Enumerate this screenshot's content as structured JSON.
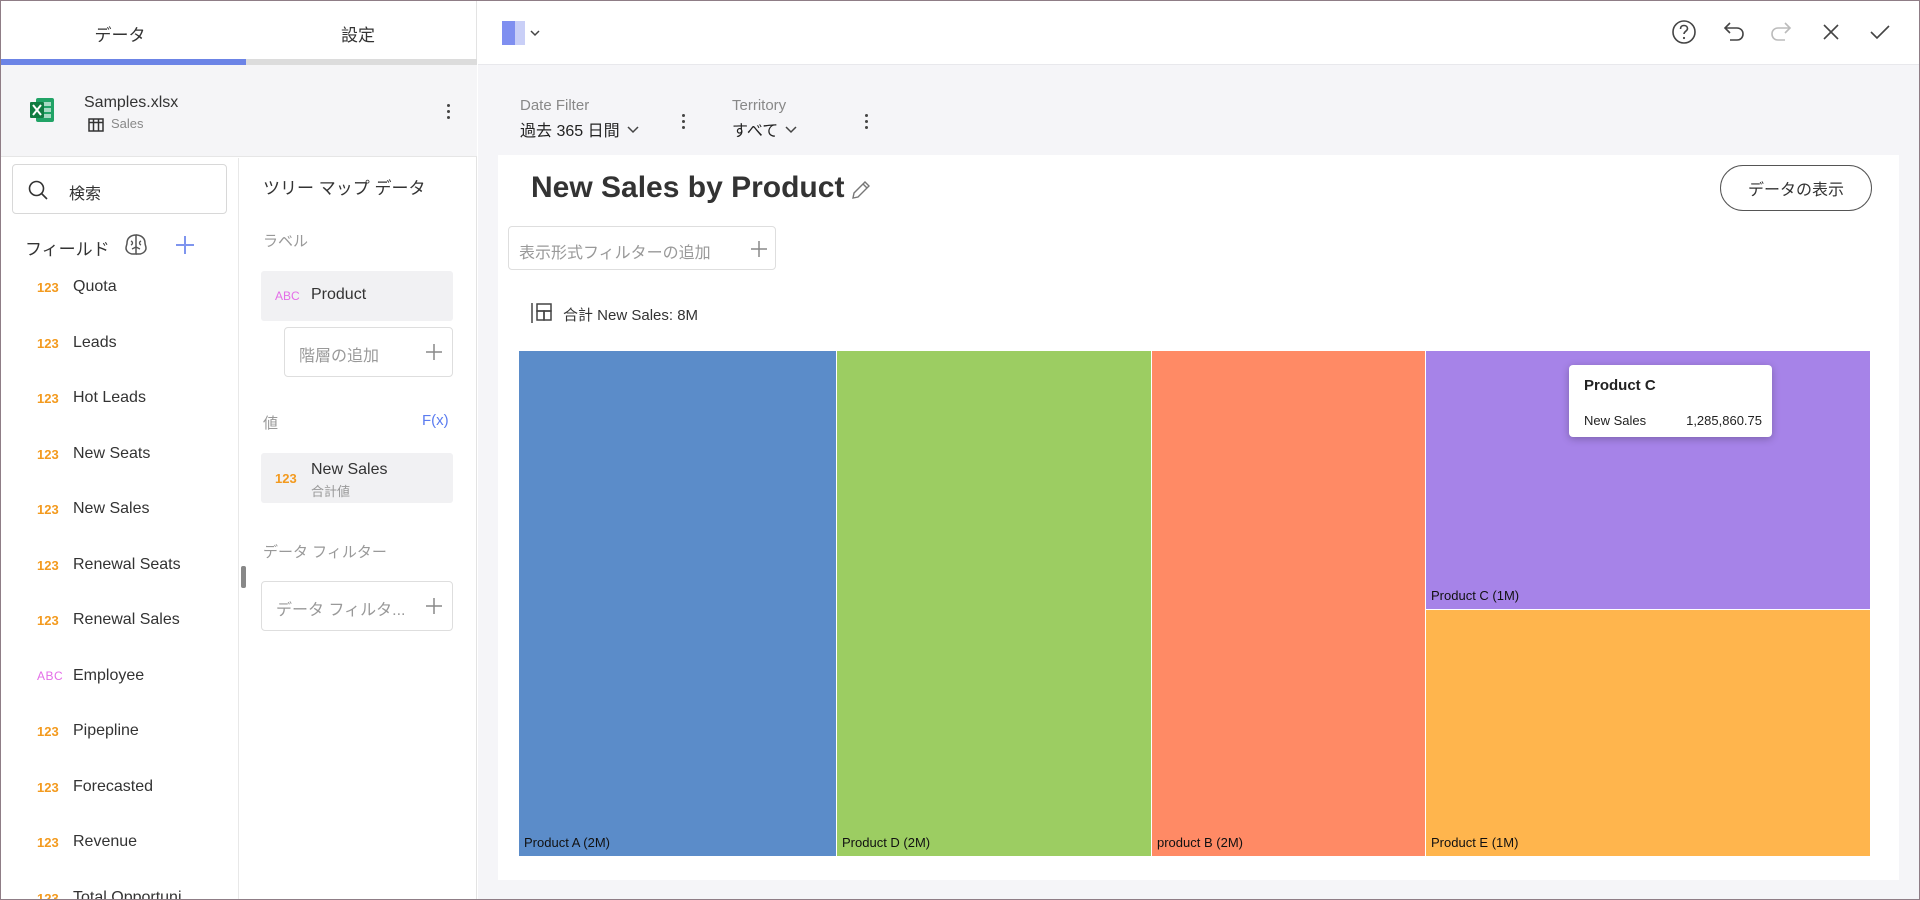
{
  "tabs": {
    "data": "データ",
    "settings": "設定"
  },
  "source": {
    "file_name": "Samples.xlsx",
    "sheet_name": "Sales"
  },
  "search": {
    "placeholder": "検索"
  },
  "fields": {
    "header": "フィールド",
    "items": [
      {
        "type": "123",
        "name": "Quota"
      },
      {
        "type": "123",
        "name": "Leads"
      },
      {
        "type": "123",
        "name": "Hot Leads"
      },
      {
        "type": "123",
        "name": "New Seats"
      },
      {
        "type": "123",
        "name": "New Sales"
      },
      {
        "type": "123",
        "name": "Renewal Seats"
      },
      {
        "type": "123",
        "name": "Renewal Sales"
      },
      {
        "type": "ABC",
        "name": "Employee"
      },
      {
        "type": "123",
        "name": "Pipepline"
      },
      {
        "type": "123",
        "name": "Forecasted"
      },
      {
        "type": "123",
        "name": "Revenue"
      },
      {
        "type": "123",
        "name": "Total Opportuni"
      }
    ]
  },
  "tree_data": {
    "title": "ツリー マップ データ",
    "label_section": "ラベル",
    "label_field": {
      "type": "ABC",
      "name": "Product"
    },
    "add_hierarchy": "階層の追加",
    "value_section": "値",
    "fx_label": "F(x)",
    "value_field": {
      "type": "123",
      "name": "New Sales",
      "aggregation": "合計値"
    },
    "data_filter_section": "データ フィルター",
    "data_filter_placeholder": "データ フィルタ..."
  },
  "filters": [
    {
      "label": "Date Filter",
      "value": "過去 365 日間"
    },
    {
      "label": "Territory",
      "value": "すべて"
    }
  ],
  "visualization": {
    "title": "New Sales by Product",
    "show_data_button": "データの表示",
    "visual_filter_placeholder": "表示形式フィルターの追加",
    "total_text": "合計 New Sales: 8M"
  },
  "chart_data": {
    "type": "treemap",
    "title": "New Sales by Product",
    "total": "合計 New Sales: 8M",
    "items": [
      {
        "label": "Product A (2M)",
        "color": "#5b8cc9"
      },
      {
        "label": "Product D (2M)",
        "color": "#9ccd62"
      },
      {
        "label": "product B (2M)",
        "color": "#ff8a65"
      },
      {
        "label": "Product C (1M)",
        "color": "#a683e8"
      },
      {
        "label": "Product E (1M)",
        "color": "#ffb54d"
      }
    ],
    "tooltip": {
      "title": "Product C",
      "key": "New Sales",
      "value": "1,285,860.75"
    }
  },
  "colors": {
    "accent": "#6c84e6",
    "numeric_type": "#f39a1e",
    "text_type": "#e46de8"
  }
}
